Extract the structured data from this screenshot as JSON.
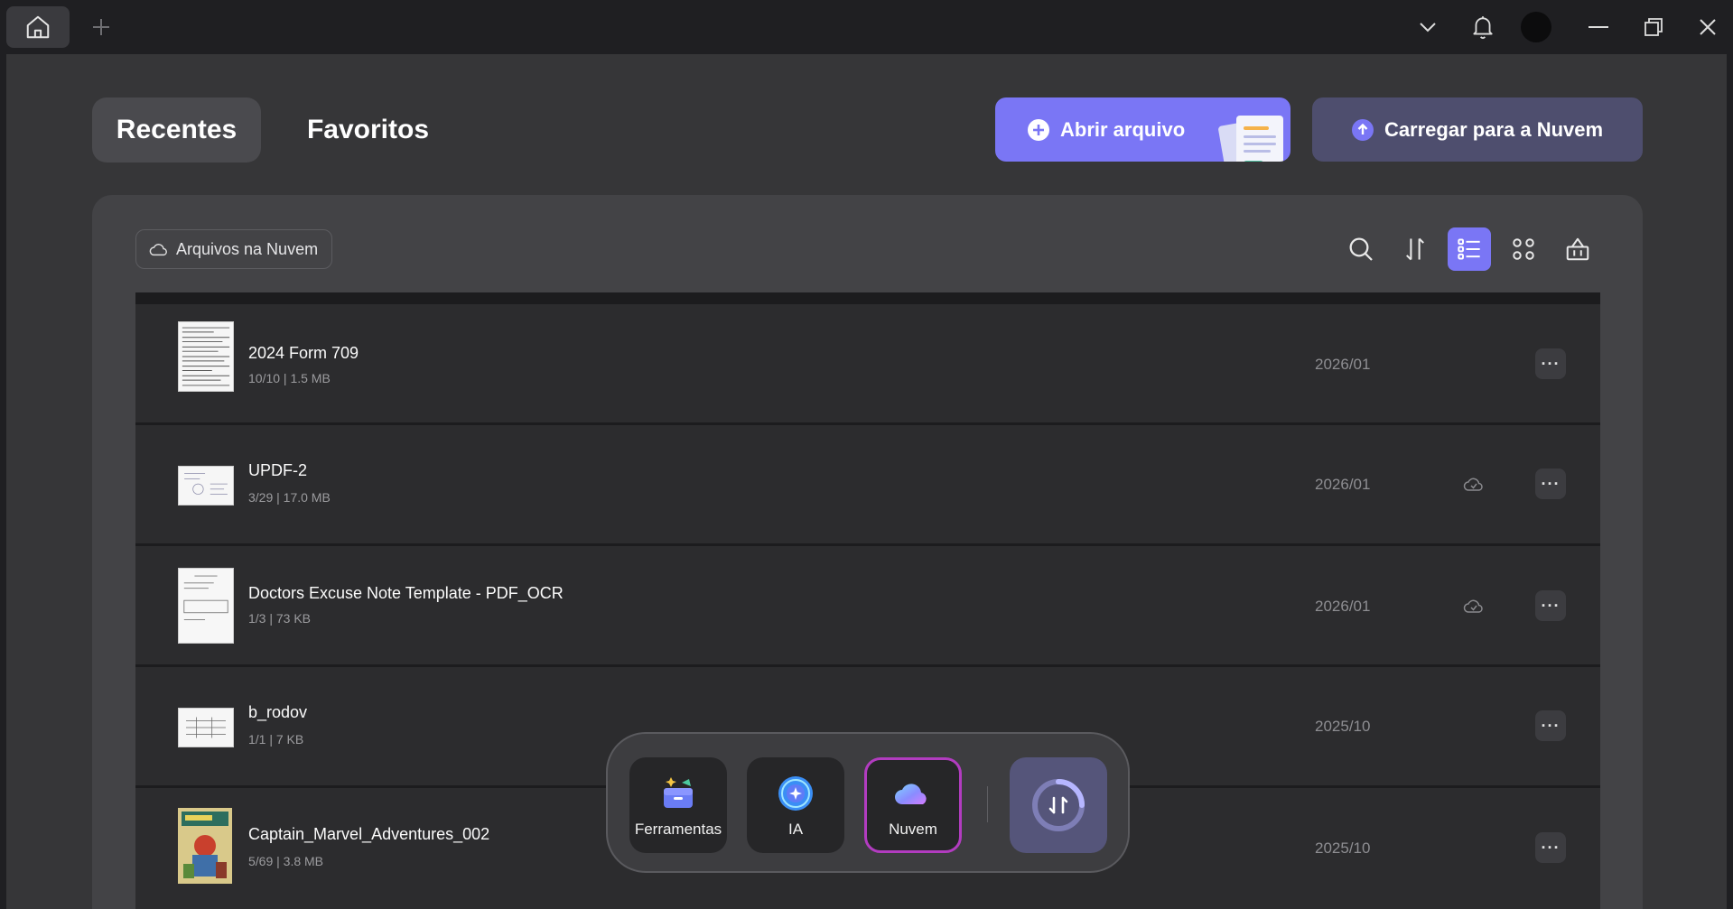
{
  "tabs": {
    "recentes": "Recentes",
    "favoritos": "Favoritos"
  },
  "actions": {
    "open_file": "Abrir arquivo",
    "upload_cloud": "Carregar para a Nuvem"
  },
  "filter": {
    "cloud_files": "Arquivos na Nuvem"
  },
  "toolbar": {
    "icons": [
      "search-icon",
      "sort-icon",
      "list-view-icon",
      "grid-view-icon",
      "basket-icon"
    ],
    "active": "list-view-icon"
  },
  "files": [
    {
      "name": "2024 Form 709",
      "meta": "10/10 | 1.5 MB",
      "date": "2026/01",
      "cloud": false
    },
    {
      "name": "UPDF-2",
      "meta": "3/29 | 17.0 MB",
      "date": "2026/01",
      "cloud": true
    },
    {
      "name": "Doctors Excuse Note Template - PDF_OCR",
      "meta": "1/3 | 73 KB",
      "date": "2026/01",
      "cloud": true
    },
    {
      "name": "b_rodov",
      "meta": "1/1 | 7 KB",
      "date": "2025/10",
      "cloud": false
    },
    {
      "name": "Captain_Marvel_Adventures_002",
      "meta": "5/69 | 3.8 MB",
      "date": "2025/10",
      "cloud": false
    }
  ],
  "more_label": "···",
  "dock": {
    "tools": "Ferramentas",
    "ai": "IA",
    "cloud": "Nuvem",
    "selected": "cloud"
  },
  "colors": {
    "accent": "#7a76f5",
    "upload_button": "#4e4e6e",
    "dock_selected_border": "#b23cc0"
  }
}
